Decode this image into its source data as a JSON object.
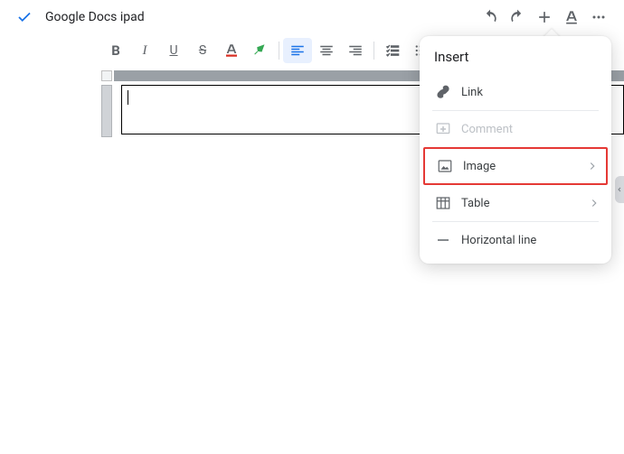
{
  "header": {
    "title": "Google Docs ipad"
  },
  "popover": {
    "title": "Insert",
    "items": {
      "link": "Link",
      "comment": "Comment",
      "image": "Image",
      "table": "Table",
      "hr": "Horizontal line"
    }
  }
}
